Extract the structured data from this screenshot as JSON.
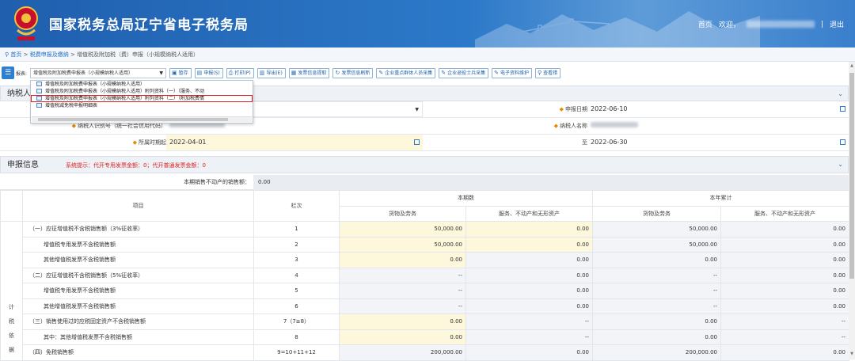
{
  "header": {
    "title": "国家税务总局辽宁省电子税务局",
    "home": "首页",
    "welcome": "欢迎，",
    "separator": "|",
    "logout": "退出"
  },
  "breadcrumb": {
    "home": "首页",
    "sep1": ">",
    "level1": "税费申报及缴纳",
    "sep2": ">",
    "current": "增值税及附加税（费）申报（小规模纳税人适用）"
  },
  "toolbar": {
    "select_label": "报表:",
    "select_value": "增值税及附加税费申报表（小规模纳税人适用）",
    "buttons": [
      {
        "label": "暂存",
        "icon": "save-icon"
      },
      {
        "label": "申报(S)",
        "icon": "submit-icon"
      },
      {
        "label": "打印(P)",
        "icon": "print-icon"
      },
      {
        "label": "导出(E)",
        "icon": "export-icon"
      },
      {
        "label": "发票信息提取",
        "icon": "invoice-icon"
      },
      {
        "label": "发票信息刷新",
        "icon": "refresh-icon"
      },
      {
        "label": "企业重点群体人员采集",
        "icon": "edit-icon"
      },
      {
        "label": "企业退役士兵采集",
        "icon": "edit-icon"
      },
      {
        "label": "电子资料维护",
        "icon": "edit-icon"
      },
      {
        "label": "查看错",
        "icon": "search-icon"
      }
    ]
  },
  "dropdown": {
    "items": [
      "增值税及附加税费申报表（小规模纳税人适用）",
      "增值税及附加税费申报表（小规模纳税人适用）附列资料（一）（服务、不动",
      "增值税及附加税费申报表（小规模纳税人适用）附列资料（二）（附加税费情",
      "增值税减免税申报明细表"
    ],
    "selected_index": 2
  },
  "taxpayer": {
    "section_title": "纳税人信息",
    "fields": {
      "declare_date_label": "申报日期",
      "declare_date": "2022-06-10",
      "taxpayer_id_label": "纳税人识别号（统一社会信用代码）",
      "taxpayer_name_label": "纳税人名称",
      "period_start_label": "所属时期起",
      "period_start": "2022-04-01",
      "period_end_label": "至",
      "period_end": "2022-06-30"
    }
  },
  "declare": {
    "section_title": "申报信息",
    "notice": "系统提示：代开专用发票金额：0；代开普通发票金额：0",
    "real_estate_label": "本期销售不动产的销售额：",
    "real_estate_value": "0.00"
  },
  "table": {
    "col_item": "项目",
    "col_line": "栏次",
    "group_current": "本期数",
    "group_ytd": "本年累计",
    "sub_goods": "货物及劳务",
    "sub_service": "服务、不动产和无形资产",
    "side_label": [
      "计",
      "税",
      "依",
      "据"
    ],
    "rows": [
      {
        "item": "（一）应征增值税不含税销售额（3%征收率）",
        "line": "1",
        "c1": "50,000.00",
        "c2": "0.00",
        "c3": "50,000.00",
        "c4": "0.00",
        "indent": false
      },
      {
        "item": "增值税专用发票不含税销售额",
        "line": "2",
        "c1": "50,000.00",
        "c2": "0.00",
        "c3": "50,000.00",
        "c4": "0.00",
        "indent": true
      },
      {
        "item": "其他增值税发票不含税销售额",
        "line": "3",
        "c1": "0.00",
        "c2": "0.00",
        "c3": "0.00",
        "c4": "0.00",
        "indent": true
      },
      {
        "item": "（二）应征增值税不含税销售额（5%征收率）",
        "line": "4",
        "c1": "--",
        "c2": "0.00",
        "c3": "--",
        "c4": "0.00",
        "indent": false
      },
      {
        "item": "增值税专用发票不含税销售额",
        "line": "5",
        "c1": "--",
        "c2": "0.00",
        "c3": "--",
        "c4": "0.00",
        "indent": true
      },
      {
        "item": "其他增值税发票不含税销售额",
        "line": "6",
        "c1": "--",
        "c2": "0.00",
        "c3": "--",
        "c4": "0.00",
        "indent": true
      },
      {
        "item": "（三）销售使用过的应税固定资产不含税销售额",
        "line": "7（7≥8）",
        "c1": "0.00",
        "c2": "--",
        "c3": "0.00",
        "c4": "--",
        "indent": false
      },
      {
        "item": "其中：其他增值税发票不含税销售额",
        "line": "8",
        "c1": "0.00",
        "c2": "--",
        "c3": "0.00",
        "c4": "--",
        "indent": true
      },
      {
        "item": "（四）免税销售额",
        "line": "9=10+11+12",
        "c1": "200,000.00",
        "c2": "0.00",
        "c3": "200,000.00",
        "c4": "0.00",
        "indent": false
      }
    ]
  }
}
